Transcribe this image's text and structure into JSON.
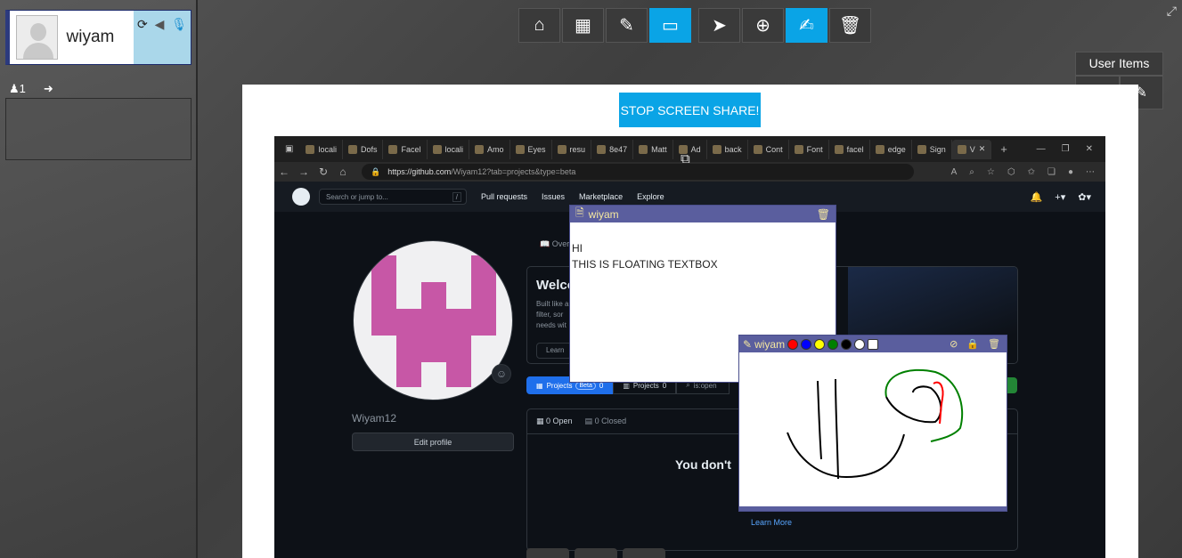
{
  "user_card": {
    "name": "wiyam"
  },
  "side": {
    "participant_count": "1"
  },
  "toolbar": {
    "buttons": [
      {
        "name": "home-button",
        "icon": "home-icon",
        "glyph": "⌂",
        "active": false
      },
      {
        "name": "grid-button",
        "icon": "grid-icon",
        "glyph": "▦",
        "active": false
      },
      {
        "name": "edit-button",
        "icon": "edit-icon",
        "glyph": "✎",
        "active": false
      },
      {
        "name": "screen-share-button",
        "icon": "monitor-icon",
        "glyph": "▭",
        "active": true
      },
      {
        "name": "pointer-button",
        "icon": "cursor-icon",
        "glyph": "➤",
        "active": false
      },
      {
        "name": "zoom-button",
        "icon": "zoom-icon",
        "glyph": "⊕",
        "active": false
      },
      {
        "name": "annotate-button",
        "icon": "annotate-icon",
        "glyph": "✍",
        "active": true
      },
      {
        "name": "trash-button",
        "icon": "trash-icon",
        "glyph": "🗑",
        "active": false
      }
    ]
  },
  "user_items": {
    "title": "User Items"
  },
  "main": {
    "stop_share_label": "STOP SCREEN SHARE!"
  },
  "browser": {
    "tabs": [
      "locali",
      "Dofs",
      "Facel",
      "locali",
      "Amo",
      "Eyes",
      "resu",
      "8e47",
      "Matt",
      "Ad",
      "back",
      "Cont",
      "Font",
      "facel",
      "edge",
      "Sign",
      "V"
    ],
    "url_host": "https://github.com",
    "url_path": "/Wiyam12?tab=projects&type=beta"
  },
  "github": {
    "search_placeholder": "Search or jump to...",
    "search_key": "/",
    "nav": [
      "Pull requests",
      "Issues",
      "Marketplace",
      "Explore"
    ],
    "overview_label": "Over",
    "username": "Wiyam12",
    "edit_profile": "Edit profile",
    "welcome_title": "Welco",
    "welcome_lines": [
      "Built like a",
      "filter, sor",
      "needs wit"
    ],
    "learn_label": "Learn",
    "projects_beta_label": "Projects",
    "beta": "Beta",
    "projects_beta_count": "0",
    "projects_label": "Projects",
    "projects_count": "0",
    "search_filter": "is:open",
    "open_count": "0 Open",
    "closed_count": "0 Closed",
    "no_projects_text": "You don't",
    "learn_more": "Learn More"
  },
  "float_text": {
    "author": "wiyam",
    "line1": "HI",
    "line2": "THIS IS FLOATING TEXTBOX"
  },
  "float_draw": {
    "author": "wiyam",
    "colors": [
      "#ff0000",
      "#0000ff",
      "#ffff00",
      "#008000",
      "#000000",
      "#ffffff"
    ]
  }
}
